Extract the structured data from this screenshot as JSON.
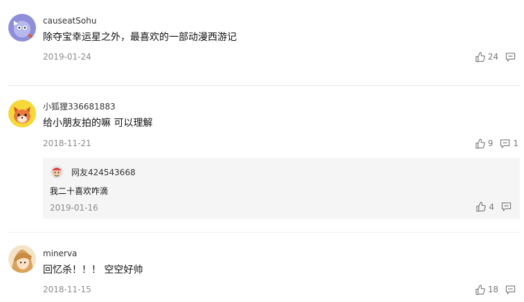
{
  "comments": [
    {
      "username": "causeatSohu",
      "content": "除夺宝幸运星之外，最喜欢的一部动漫西游记",
      "date": "2019-01-24",
      "likes": "24",
      "replies": ""
    },
    {
      "username": "小狐狸336681883",
      "content": "给小朋友拍的嘛 可以理解",
      "date": "2018-11-21",
      "likes": "9",
      "replies": "1",
      "reply": {
        "username": "网友424543668",
        "content": "我二十喜欢咋滴",
        "date": "2019-01-16",
        "likes": "4"
      }
    },
    {
      "username": "minerva",
      "content": "回忆杀！！！ 空空好帅",
      "date": "2018-11-15",
      "likes": "18",
      "replies": ""
    }
  ],
  "colors": {
    "meta_text": "#8a8a8a",
    "icon": "#777777",
    "divider": "#ececec",
    "reply_bg": "#f5f5f6"
  },
  "icons": {
    "like": "thumbs-up-icon",
    "reply": "comment-icon"
  }
}
